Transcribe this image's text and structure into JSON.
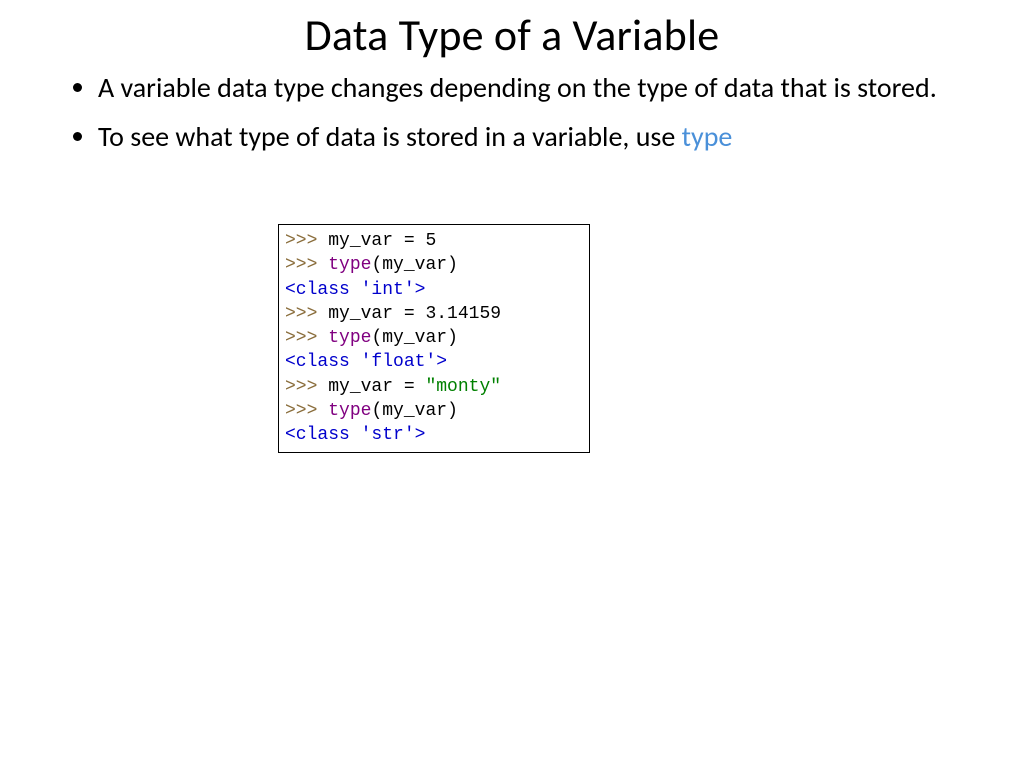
{
  "title": "Data Type of a Variable",
  "bullets": {
    "b1": "A variable data type changes depending on the type of data that is stored.",
    "b2_prefix": "To see what type of data is stored in a variable, use ",
    "b2_kw": "type"
  },
  "code": {
    "prompt": ">>> ",
    "var_name": "my_var",
    "assign_op": " = ",
    "val_int": "5",
    "val_float": "3.14159",
    "val_str_q": "\"monty\"",
    "type_fn": "type",
    "paren_open": "(",
    "paren_close": ")",
    "out_int": "<class 'int'>",
    "out_float": "<class 'float'>",
    "out_str": "<class 'str'>"
  }
}
